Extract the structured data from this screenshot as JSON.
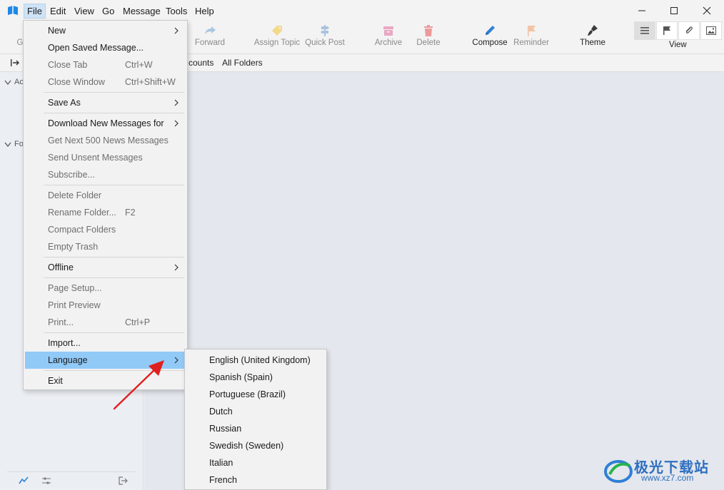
{
  "menubar": {
    "items": [
      "File",
      "Edit",
      "View",
      "Go",
      "Message",
      "Tools",
      "Help"
    ]
  },
  "toolbar": {
    "get_messages_partial": "G",
    "forward": "Forward",
    "assign_topic": "Assign Topic",
    "quick_post": "Quick Post",
    "archive": "Archive",
    "delete": "Delete",
    "compose": "Compose",
    "reminder": "Reminder",
    "theme": "Theme",
    "view": "View"
  },
  "folderbar": {
    "accounts_partial": "counts",
    "all_folders": "All Folders"
  },
  "sidepanel": {
    "accounts_partial": "Ac",
    "folders_partial": "Fo"
  },
  "file_menu": {
    "items": [
      {
        "label": "New",
        "shortcut": "",
        "submenu": true,
        "disabled": false
      },
      {
        "label": "Open Saved Message...",
        "shortcut": "",
        "submenu": false,
        "disabled": false
      },
      {
        "label": "Close Tab",
        "shortcut": "Ctrl+W",
        "submenu": false,
        "disabled": true
      },
      {
        "label": "Close Window",
        "shortcut": "Ctrl+Shift+W",
        "submenu": false,
        "disabled": true
      },
      {
        "label": "Save As",
        "shortcut": "",
        "submenu": true,
        "disabled": false
      },
      {
        "label": "Download New Messages for",
        "shortcut": "",
        "submenu": true,
        "disabled": false
      },
      {
        "label": "Get Next 500 News Messages",
        "shortcut": "",
        "submenu": false,
        "disabled": true
      },
      {
        "label": "Send Unsent Messages",
        "shortcut": "",
        "submenu": false,
        "disabled": true
      },
      {
        "label": "Subscribe...",
        "shortcut": "",
        "submenu": false,
        "disabled": true
      },
      {
        "label": "Delete Folder",
        "shortcut": "",
        "submenu": false,
        "disabled": true
      },
      {
        "label": "Rename Folder...",
        "shortcut": "F2",
        "submenu": false,
        "disabled": true
      },
      {
        "label": "Compact Folders",
        "shortcut": "",
        "submenu": false,
        "disabled": true
      },
      {
        "label": "Empty Trash",
        "shortcut": "",
        "submenu": false,
        "disabled": true
      },
      {
        "label": "Offline",
        "shortcut": "",
        "submenu": true,
        "disabled": false
      },
      {
        "label": "Page Setup...",
        "shortcut": "",
        "submenu": false,
        "disabled": true
      },
      {
        "label": "Print Preview",
        "shortcut": "",
        "submenu": false,
        "disabled": true
      },
      {
        "label": "Print...",
        "shortcut": "Ctrl+P",
        "submenu": false,
        "disabled": true
      },
      {
        "label": "Import...",
        "shortcut": "",
        "submenu": false,
        "disabled": false
      },
      {
        "label": "Language",
        "shortcut": "",
        "submenu": true,
        "disabled": false,
        "highlighted": true
      },
      {
        "label": "Exit",
        "shortcut": "",
        "submenu": false,
        "disabled": false
      }
    ]
  },
  "language_menu": {
    "items": [
      "English (United Kingdom)",
      "Spanish (Spain)",
      "Portuguese (Brazil)",
      "Dutch",
      "Russian",
      "Swedish (Sweden)",
      "Italian",
      "French"
    ]
  },
  "watermark": {
    "title": "极光下载站",
    "url": "www.xz7.com"
  },
  "colors": {
    "highlight": "#91c9f7",
    "arrow": "#e02020",
    "compose_icon": "#2f7fd6",
    "accent": "#1e88e5"
  }
}
